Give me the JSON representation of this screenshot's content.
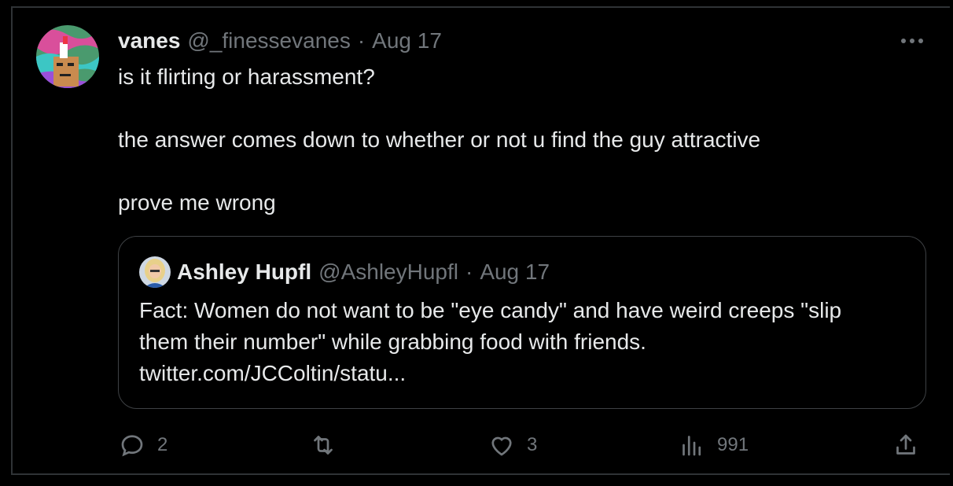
{
  "tweet": {
    "author_name": "vanes",
    "author_handle": "@_finessevanes",
    "separator": "·",
    "date": "Aug 17",
    "lines": [
      "is it flirting or harassment?",
      "",
      "the answer comes down to whether or not u find the guy attractive",
      "",
      "prove me wrong"
    ],
    "more_icon": "more-horizontal-icon"
  },
  "quoted": {
    "author_name": "Ashley Hupfl",
    "author_handle": "@AshleyHupfl",
    "separator": "·",
    "date": "Aug 17",
    "lines": [
      "Fact: Women do not want to be \"eye candy\" and have weird creeps \"slip",
      "them their number\" while grabbing food with friends.",
      "twitter.com/JCColtin/statu..."
    ]
  },
  "actions": {
    "replies": "2",
    "retweets": "",
    "likes": "3",
    "views": "991",
    "icons": [
      "reply-icon",
      "retweet-icon",
      "like-icon",
      "views-icon",
      "share-icon"
    ]
  },
  "colors": {
    "background": "#000000",
    "text": "#e7e9ea",
    "muted": "#71767b",
    "border": "#2f3336"
  }
}
